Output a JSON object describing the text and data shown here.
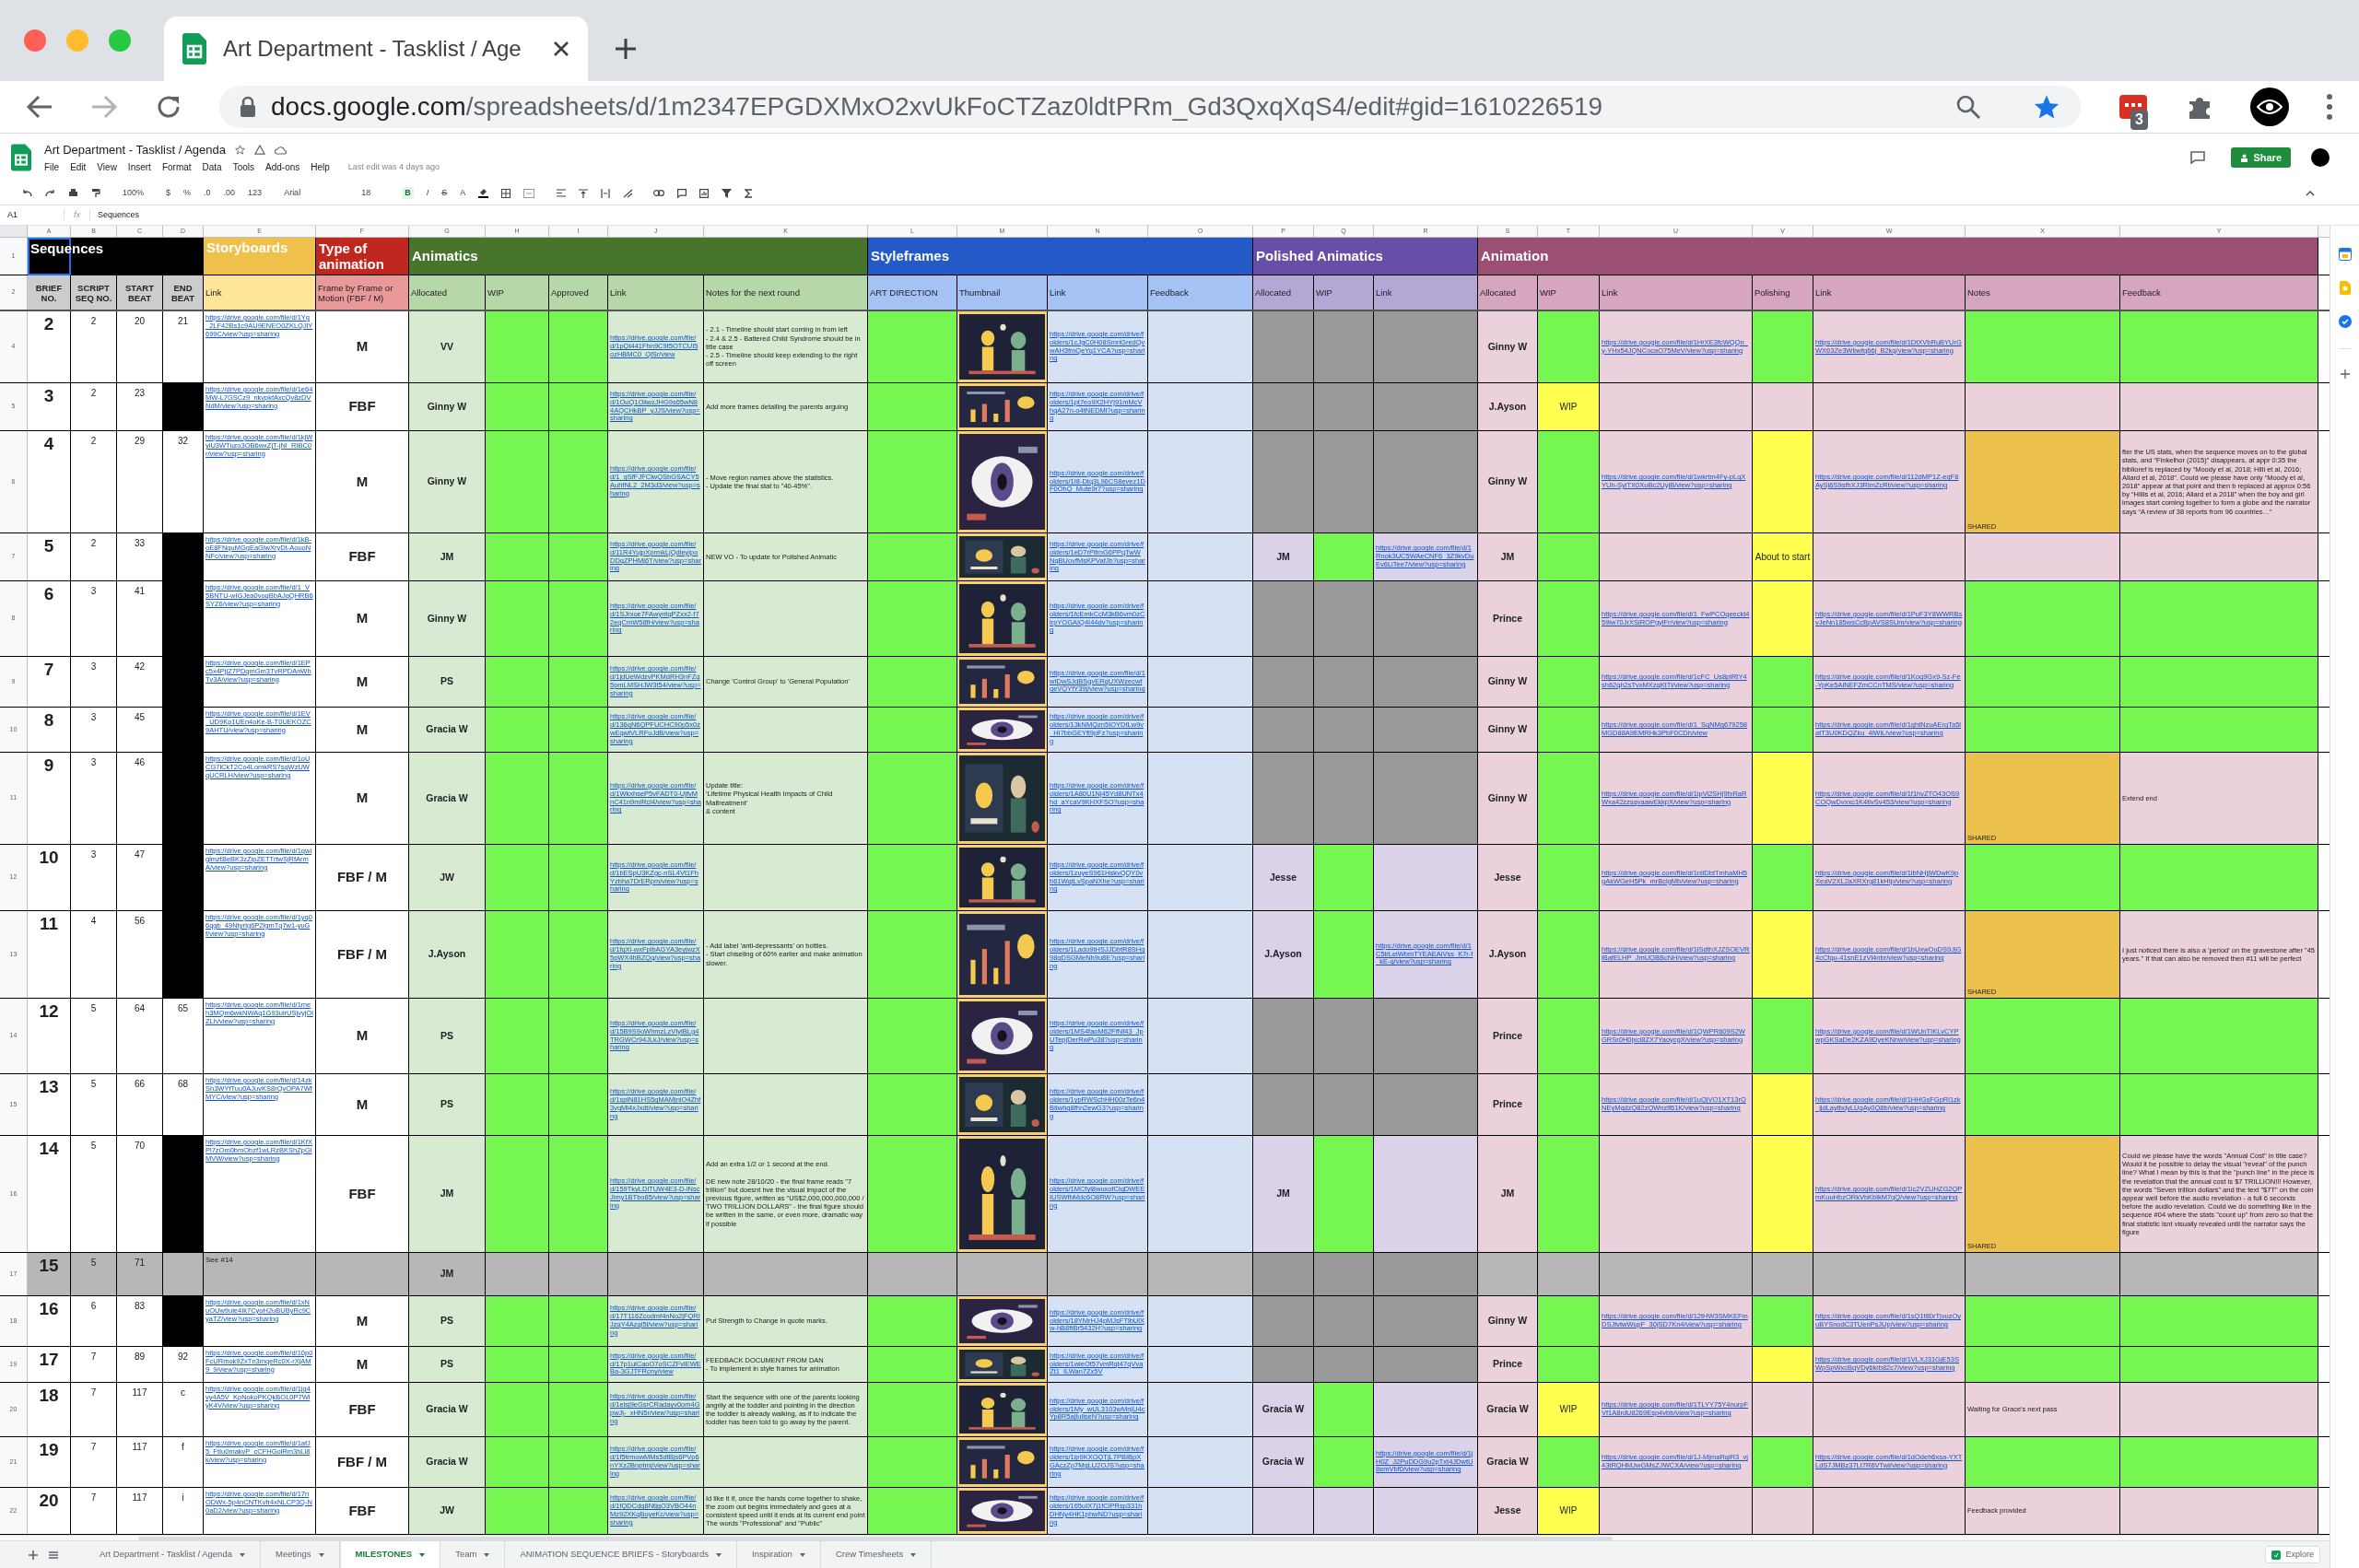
{
  "browser": {
    "tab_title": "Art Department - Tasklist / Age",
    "url_host": "docs.google.com",
    "url_path": "/spreadsheets/d/1m2347EPGDXMxO2xvUkFoCTZaz0ldtPRm_Gd3QxqXqS4/edit#gid=1610226519",
    "extension_badge": "3"
  },
  "doc": {
    "title": "Art Department - Tasklist / Agenda",
    "menu": [
      "File",
      "Edit",
      "View",
      "Insert",
      "Format",
      "Data",
      "Tools",
      "Add-ons",
      "Help"
    ],
    "last_edit": "Last edit was 4 days ago",
    "share": "Share"
  },
  "toolbar": {
    "zoom": "100%",
    "currency": "$",
    "percent": "%",
    "decrease_decimals": ".0",
    "increase_decimals": ".00",
    "number_format": "123",
    "font": "Arial",
    "font_size": "18",
    "bold": "B",
    "italic": "I",
    "strikethrough": "S",
    "text_color": "A"
  },
  "formula_bar": {
    "cell": "A1",
    "fx": "fx",
    "content": "Sequences"
  },
  "sections": [
    {
      "kind": "sequences",
      "title": "Sequences",
      "selected": true,
      "columns": [
        {
          "letter": "A",
          "header": "BRIEF NO.",
          "kind": "brief"
        },
        {
          "letter": "B",
          "header": "SCRIPT SEQ NO.",
          "kind": "number"
        },
        {
          "letter": "C",
          "header": "START BEAT",
          "kind": "number"
        },
        {
          "letter": "D",
          "header": "END BEAT",
          "kind": "number"
        }
      ]
    },
    {
      "kind": "storyboards",
      "title": "Storyboards",
      "selected": false,
      "columns": [
        {
          "letter": "E",
          "header": "Link",
          "kind": "link"
        }
      ]
    },
    {
      "kind": "type",
      "title": "Type of animation",
      "selected": false,
      "columns": [
        {
          "letter": "F",
          "header": "Frame by Frame or Motion (FBF / M)",
          "kind": "type"
        }
      ]
    },
    {
      "kind": "animatics",
      "title": "Animatics",
      "selected": false,
      "columns": [
        {
          "letter": "G",
          "header": "Allocated",
          "kind": "name"
        },
        {
          "letter": "H",
          "header": "WIP",
          "kind": "status"
        },
        {
          "letter": "I",
          "header": "Approved",
          "kind": "status"
        },
        {
          "letter": "J",
          "header": "Link",
          "kind": "link"
        },
        {
          "letter": "K",
          "header": "Notes for the next round",
          "kind": "note"
        }
      ]
    },
    {
      "kind": "styleframes",
      "title": "Styleframes",
      "selected": false,
      "columns": [
        {
          "letter": "L",
          "header": "ART DIRECTION",
          "kind": "status"
        },
        {
          "letter": "M",
          "header": "Thumbnail",
          "kind": "thumbnail"
        },
        {
          "letter": "N",
          "header": "Link",
          "kind": "link"
        },
        {
          "letter": "O",
          "header": "Feedback",
          "kind": "note"
        }
      ]
    },
    {
      "kind": "polished",
      "title": "Polished Animatics",
      "selected": false,
      "columns": [
        {
          "letter": "P",
          "header": "Allocated",
          "kind": "name"
        },
        {
          "letter": "Q",
          "header": "WIP",
          "kind": "status"
        },
        {
          "letter": "R",
          "header": "Link",
          "kind": "link"
        }
      ]
    },
    {
      "kind": "animation",
      "title": "Animation",
      "selected": false,
      "columns": [
        {
          "letter": "S",
          "header": "Allocated",
          "kind": "name"
        },
        {
          "letter": "T",
          "header": "WIP",
          "kind": "status"
        },
        {
          "letter": "U",
          "header": "Link",
          "kind": "link"
        },
        {
          "letter": "V",
          "header": "Polishing",
          "kind": "status"
        },
        {
          "letter": "W",
          "header": "Link",
          "kind": "link"
        },
        {
          "letter": "X",
          "header": "Notes",
          "kind": "note"
        },
        {
          "letter": "Y",
          "header": "Feedback",
          "kind": "note"
        }
      ]
    }
  ],
  "header_row_numbers": [
    "1",
    "2"
  ],
  "rows": [
    {
      "number": "4",
      "cells": [
        {
          "text": "2"
        },
        {
          "text": "2"
        },
        {
          "text": "20"
        },
        {
          "text": "21"
        },
        {
          "text": "https://drive.google.com/file/d/1Yg_2LF42Bs1c9AU9ENEO0ZKLQJlY699C/view?usp=sharing"
        },
        {
          "text": "M"
        },
        {
          "text": "VV"
        },
        {
          "color": "#76f650"
        },
        {
          "color": "#76f650"
        },
        {
          "text": "https://drive.google.com/file/d/1pQt441Fhn9C9t5OTCUI5ozHBMC0_QlSr/view"
        },
        {
          "text": "- 2.1 - Timeline should start coming in from left\n- 2.4 & 2.5 - Battered Child Syndrome should be in title case\n- 2.5 - Timeline should keep extending to the right off screen"
        },
        {
          "color": "#76f650"
        },
        {
          "kind": "picture"
        },
        {
          "text": "https://drive.google.com/drive/folders/1cJgC0H08SmriGredQvwAH3fmQeYq1YCA?usp=sharing"
        },
        {},
        {
          "color": "#999999"
        },
        {
          "color": "#999999"
        },
        {
          "color": "#999999"
        },
        {
          "text": "Ginny W"
        },
        {
          "color": "#76f650"
        },
        {
          "text": "https://drive.google.com/file/d/1HrXE3fcWQQn_y-YHx54JQNCocaO75MeV/view?usp=sharing"
        },
        {
          "color": "#76f650"
        },
        {
          "text": "https://drive.google.com/file/d/1DtXVbRuBYUrGWX63Ze3Wbwfq66j_B2kq/view?usp=sharing"
        },
        {
          "color": "#76f650"
        },
        {
          "color": "#76f650"
        }
      ]
    },
    {
      "number": "5",
      "cells": [
        {
          "text": "3"
        },
        {
          "text": "2"
        },
        {
          "text": "23"
        },
        {
          "color": "#000000"
        },
        {
          "text": "https://drive.google.com/file/d/1e64MW-L7GSCz9_nkvpkfAxcQv8zDVNdM/view?usp=sharing"
        },
        {
          "text": "FBF"
        },
        {
          "text": "Ginny W"
        },
        {
          "color": "#76f650"
        },
        {
          "color": "#76f650"
        },
        {
          "text": "https://drive.google.com/file/d/1OuQ1OiiwzJHG9s65wN84AQCHkBP_yJJS/view?usp=sharing"
        },
        {
          "text": "Add more frames detailing the parents arguing"
        },
        {
          "color": "#76f650"
        },
        {
          "kind": "picture"
        },
        {
          "text": "https://drive.google.com/drive/folders/1pt7eo9X2HYj91mMcVhqA27n-o4tNEDMl?usp=sharing"
        },
        {},
        {
          "color": "#999999"
        },
        {
          "color": "#999999"
        },
        {
          "color": "#999999"
        },
        {
          "text": "J.Ayson"
        },
        {
          "text": "WIP",
          "color": "#ffff50"
        },
        {},
        {},
        {},
        {},
        {}
      ]
    },
    {
      "number": "6",
      "cells": [
        {
          "text": "4"
        },
        {
          "text": "2"
        },
        {
          "text": "29"
        },
        {
          "text": "32"
        },
        {
          "text": "https://drive.google.com/file/d/1kjWyiU3WTuzo3OB6wxZjT-jNI_RIBC0r/view?usp=sharing"
        },
        {
          "text": "M"
        },
        {
          "text": "Ginny W"
        },
        {
          "color": "#76f650"
        },
        {
          "color": "#76f650"
        },
        {
          "text": "https://drive.google.com/file/d/1_gSfFJFClwQSbGSACY5AuhfNL2_2M3d3/view?usp=sharing"
        },
        {
          "text": "- Move region names above the statistics.\n- Update the final stat to \"40-45%\"."
        },
        {
          "color": "#76f650"
        },
        {
          "kind": "picture"
        },
        {
          "text": "https://drive.google.com/drive/folders/1I8-Dtq3L96CS8evez1DF0OhQ_Mute9r7?usp=sharing"
        },
        {},
        {
          "color": "#999999"
        },
        {
          "color": "#999999"
        },
        {
          "color": "#999999"
        },
        {
          "text": "Ginny W"
        },
        {
          "color": "#76f650"
        },
        {
          "text": "https://drive.google.com/file/d/1wkrtm4Fy-pLqXYUh-SyiTX0XuBc2UyjB/view?usp=sharing"
        },
        {
          "color": "#ffff50"
        },
        {
          "text": "https://drive.google.com/file/d/112dMP1Z-egF8AySj6S9sfhXJ3RlmZcRt/view?usp=sharing"
        },
        {
          "text": "SHARED",
          "color": "#ecc04c"
        },
        {
          "text": "fter the US stats, when the sequence moves on to the global stats, and “Finkelhor (2015)” disappears, at appr 0:35 the biblioref is replaced by “Moody et al, 2018; Hilli et al, 2016; Allard et al, 2018”. Could we please have only “Moody et al, 2018” appear at that point and then b replaced at approx 0:56 by “Hillis et al, 2016; Allard et a 2018” when the boy and girl images start coming together to form a globe and the narrator says “A review of 38 reports from 96 countries…”"
        }
      ]
    },
    {
      "number": "7",
      "cells": [
        {
          "text": "5"
        },
        {
          "text": "2"
        },
        {
          "text": "33"
        },
        {
          "color": "#000000"
        },
        {
          "text": "https://drive.google.com/file/d/1kB-oE8FNquMGgEaGlwXryDt-AouoNNFc/view?usp=sharing"
        },
        {
          "text": "FBF"
        },
        {
          "text": "JM"
        },
        {
          "color": "#76f650"
        },
        {
          "color": "#76f650"
        },
        {
          "text": "https://drive.google.com/file/d/11R4YujpXprmkLjQdleyipoDDqZPHMj6T/view?usp=sharing"
        },
        {
          "text": "NEW VO - To update for Polished Animatic"
        },
        {
          "color": "#76f650"
        },
        {
          "kind": "picture"
        },
        {
          "text": "https://drive.google.com/drive/folders/1eD7rPlfmG6PPqTwWNqBUovfMsKPVafJb?usp=sharing"
        },
        {},
        {
          "text": "JM"
        },
        {
          "color": "#76f650"
        },
        {
          "text": "https://drive.google.com/file/d/1Rnok3UC5WAeCNF6_3Z9kvDuEv6LiTee7/view?usp=sharing"
        },
        {
          "text": "JM"
        },
        {
          "color": "#76f650"
        },
        {},
        {
          "text": "About to start",
          "color": "#ffff50"
        },
        {},
        {},
        {}
      ]
    },
    {
      "number": "8",
      "cells": [
        {
          "text": "6"
        },
        {
          "text": "3"
        },
        {
          "text": "41"
        },
        {
          "color": "#000000"
        },
        {
          "text": "https://drive.google.com/file/d/1_V5BNTU-wIGJea0voqBbAJqQHRB6SYZ6/view?usp=sharing"
        },
        {
          "text": "M"
        },
        {
          "text": "Ginny W"
        },
        {
          "color": "#76f650"
        },
        {
          "color": "#76f650"
        },
        {
          "text": "https://drive.google.com/file/d/1SJrxoe7FAwyntqPZxx2-f72eqCmW58fH/view?usp=sharing"
        },
        {},
        {
          "color": "#76f650"
        },
        {
          "kind": "picture"
        },
        {
          "text": "https://drive.google.com/drive/folders/1fcEmkCcM3kB6vm0zClrpYOGAIQ4I44dv?usp=sharing"
        },
        {},
        {
          "color": "#999999"
        },
        {
          "color": "#999999"
        },
        {
          "color": "#999999"
        },
        {
          "text": "Prince"
        },
        {
          "color": "#76f650"
        },
        {
          "text": "https://drive.google.com/file/d/1_FwPCOqeeckt459iw70JrXSiROPgylFr/view?usp=sharing"
        },
        {
          "color": "#ffff50"
        },
        {
          "text": "https://drive.google.com/file/d/1PuF3Y8WWRBsvJeNn185wsCcBpAVS8SUm/view?usp=sharing"
        },
        {
          "color": "#76f650"
        },
        {
          "color": "#76f650"
        }
      ]
    },
    {
      "number": "9",
      "cells": [
        {
          "text": "7"
        },
        {
          "text": "3"
        },
        {
          "text": "42"
        },
        {
          "color": "#000000"
        },
        {
          "text": "https://drive.google.com/file/d/1EPc5x4PjjZ7PDqmGm3TvRPDAnWhTv3A/view?usp=sharing"
        },
        {
          "text": "M"
        },
        {
          "text": "PS"
        },
        {
          "color": "#76f650"
        },
        {
          "color": "#76f650"
        },
        {
          "text": "https://drive.google.com/file/d/1jdUeWdzvPKMdRH3nFZq5pmLMSHJW3t54/view?usp=sharing"
        },
        {
          "text": "Change 'Control Group' to 'General Population'"
        },
        {
          "color": "#76f650"
        },
        {
          "kind": "picture"
        },
        {
          "text": "https://drive.google.com/file/d/1wtDwSJdBSgvERqUXWzecwfqeVQYfY39j/view?usp=sharing"
        },
        {},
        {
          "color": "#999999"
        },
        {
          "color": "#999999"
        },
        {
          "color": "#999999"
        },
        {
          "text": "Ginny W"
        },
        {
          "color": "#76f650"
        },
        {
          "text": "https://drive.google.com/file/d/1cFC_Us8piRtY4sh62qh2sTvxMXzqKtTi/view?usp=sharing"
        },
        {
          "color": "#76f650"
        },
        {
          "text": "https://drive.google.com/file/d/1Koq9Gx9-Sz-Fe-YpKe5AlNEFZmCCnTMS/view?usp=sharing"
        },
        {
          "color": "#76f650"
        },
        {
          "color": "#76f650"
        }
      ]
    },
    {
      "number": "10",
      "cells": [
        {
          "text": "8"
        },
        {
          "text": "3"
        },
        {
          "text": "45"
        },
        {
          "color": "#000000"
        },
        {
          "text": "https://drive.google.com/file/d/1EV_UD9Kp1UEn4oKe-B-T0UEKOZC9AHTU/view?usp=sharing"
        },
        {
          "text": "M"
        },
        {
          "text": "Gracia W"
        },
        {
          "color": "#76f650"
        },
        {
          "color": "#76f650"
        },
        {
          "text": "https://drive.google.com/file/d/136qN6QPFUCHC90p5x0zwEqwtVLRFuJdB/view?usp=sharing"
        },
        {},
        {
          "color": "#76f650"
        },
        {
          "kind": "picture"
        },
        {
          "text": "https://drive.google.com/drive/folders/13kNMQzn5IOYDtLw9v_HI7bbGEYfl9pFz?usp=sharing"
        },
        {},
        {
          "color": "#999999"
        },
        {
          "color": "#999999"
        },
        {
          "color": "#999999"
        },
        {
          "text": "Ginny W"
        },
        {
          "color": "#76f650"
        },
        {
          "text": "https://drive.google.com/file/d/1_SqNMg679258MGD88A9EMRHk3PbF0CDh/view"
        },
        {
          "color": "#76f650"
        },
        {
          "text": "https://drive.google.com/file/d/1ghtNzuAErqTa5latT3U0KDQZku_4iWiL/view?usp=sharing"
        },
        {
          "color": "#76f650"
        },
        {
          "color": "#76f650"
        }
      ]
    },
    {
      "number": "11",
      "cells": [
        {
          "text": "9"
        },
        {
          "text": "3"
        },
        {
          "text": "46"
        },
        {
          "color": "#000000"
        },
        {
          "text": "https://drive.google.com/file/d/1oUCG7lCkT2Co4LomkRS7sqWzUWqUCRLH/view?usp=sharing"
        },
        {
          "text": "M"
        },
        {
          "text": "Gracia W"
        },
        {
          "color": "#76f650"
        },
        {
          "color": "#76f650"
        },
        {
          "text": "https://drive.google.com/file/d/1WkxhseP5vFADT0-UjfvMnC41n9mlRcl4/view?usp=sharing"
        },
        {
          "text": "Update title:\n'Lifetime Physical Health Impacts of Child Maltreatment'\n& content"
        },
        {
          "color": "#76f650"
        },
        {
          "kind": "picture"
        },
        {
          "text": "https://drive.google.com/drive/folders/1A80U1Nj45Yd8UNTx4hd_aYcaV9KHXFSO?usp=sharing"
        },
        {},
        {
          "color": "#999999"
        },
        {
          "color": "#999999"
        },
        {
          "color": "#999999"
        },
        {
          "text": "Ginny W"
        },
        {
          "color": "#76f650"
        },
        {
          "text": "https://drive.google.com/file/d/1ipVi2SHj9fxRaRWxa42zzsqvaawEkkpX/view?usp=sharing"
        },
        {
          "color": "#ffff50"
        },
        {
          "text": "https://drive.google.com/file/d/1f1hvZTO43OS9COQwDvxxc1K4tivSv453/view?usp=sharing"
        },
        {
          "text": "SHARED",
          "color": "#ecc04c"
        },
        {
          "text": "Extend end"
        }
      ]
    },
    {
      "number": "12",
      "cells": [
        {
          "text": "10"
        },
        {
          "text": "3"
        },
        {
          "text": "47"
        },
        {
          "color": "#000000"
        },
        {
          "text": "https://drive.google.com/file/d/1qwiglmztBeBK3zZipZETTrtwSjRfArmA/view?usp=sharing"
        },
        {
          "text": "FBF / M"
        },
        {
          "text": "JW"
        },
        {
          "color": "#76f650"
        },
        {
          "color": "#76f650"
        },
        {
          "text": "https://drive.google.com/file/d/1bESpU3KZgc-nSL4Vt1FhYzbha7DrERpm/view?usp=sharing"
        },
        {},
        {
          "color": "#76f650"
        },
        {
          "kind": "picture"
        },
        {
          "text": "https://drive.google.com/drive/folders/1zuyeS961HskvQQY0vb61WqtLvSpaNXhe?usp=sharing"
        },
        {},
        {
          "text": "Jesse"
        },
        {
          "color": "#76f650"
        },
        {},
        {
          "text": "Jesse"
        },
        {
          "color": "#76f650"
        },
        {
          "text": "https://drive.google.com/file/d/1nliDbtTmhaMH5gAkWGeH5Pk_mrBclgMb/view?usp=sharing"
        },
        {
          "color": "#76f650"
        },
        {
          "text": "https://drive.google.com/file/d/1lbNHjjWDwK9pXeaV2XL2aXRXrg81kHIp/view?usp=sharing"
        },
        {
          "color": "#76f650"
        },
        {
          "color": "#76f650"
        }
      ]
    },
    {
      "number": "13",
      "cells": [
        {
          "text": "11"
        },
        {
          "text": "4"
        },
        {
          "text": "56"
        },
        {
          "color": "#000000"
        },
        {
          "text": "https://drive.google.com/file/d/1yq06qgb_49NtyrIg6P2lgmTq7w1-yuGf/view?usp=sharing"
        },
        {
          "text": "FBF / M"
        },
        {
          "text": "J.Ayson"
        },
        {
          "color": "#76f650"
        },
        {
          "color": "#76f650"
        },
        {
          "text": "https://drive.google.com/file/d/1fqXi-wxFplbAGYA3eyjwzX5pWX4hBZQq/view?usp=sharing"
        },
        {
          "text": "- Add label 'anti-depressants' on bottles.\n- Start chiseling of 60% earlier and make animation slower."
        },
        {
          "color": "#76f650"
        },
        {
          "kind": "picture"
        },
        {
          "text": "https://drive.google.com/drive/folders/1Lado9tHSJJDbtR8SHg98gDSGMeNh9u8E?usp=sharing"
        },
        {},
        {
          "text": "J.Ayson"
        },
        {
          "color": "#76f650"
        },
        {
          "text": "https://drive.google.com/file/d/1C5lrLeiWbmTYEAEAiVss_K7r-f_kE-q/view?usp=sharing"
        },
        {
          "text": "J.Ayson"
        },
        {
          "color": "#76f650"
        },
        {
          "text": "https://drive.google.com/file/d/1lSdthXJZSOEVRlBafELHP_JmUQBBcNH/view?usp=sharing"
        },
        {
          "color": "#ffff50"
        },
        {
          "text": "https://drive.google.com/file/d/1bUxwOuDS9JjG4cCfqu-41snE1zVl4nbr/view?usp=sharing"
        },
        {
          "text": "SHARED",
          "color": "#ecc04c"
        },
        {
          "text": "I just noticed there is also a 'period' on the gravestone after \"45 years.\" If that can also be removed then #11 will be perfect"
        }
      ]
    },
    {
      "number": "14",
      "cells": [
        {
          "text": "12"
        },
        {
          "text": "5"
        },
        {
          "text": "64"
        },
        {
          "text": "65"
        },
        {
          "text": "https://drive.google.com/file/d/1meh3MQm6wkNWAq1G93ulrUSjvyjOlZLh/view?usp=sharing"
        },
        {
          "text": "M"
        },
        {
          "text": "PS"
        },
        {
          "color": "#76f650"
        },
        {
          "color": "#76f650"
        },
        {
          "text": "https://drive.google.com/file/d/15B9S9oWhmzLzVIyiBLg4TRGWCr94JLkJ/view?usp=sharing"
        },
        {},
        {
          "color": "#76f650"
        },
        {
          "kind": "picture"
        },
        {
          "text": "https://drive.google.com/drive/folders/1MS4faoM62FfNf43_JpUTepjDerRwPu38?usp=sharing"
        },
        {},
        {
          "color": "#999999"
        },
        {
          "color": "#999999"
        },
        {
          "color": "#999999"
        },
        {
          "text": "Prince"
        },
        {
          "color": "#76f650"
        },
        {
          "text": "https://drive.google.com/file/d/1QWPR609S2WGRSr0H0jxci8ZX7YaoycgX/view?usp=sharing"
        },
        {
          "color": "#76f650"
        },
        {
          "text": "https://drive.google.com/file/d/1WUnTIKLvCYPwpGKSaDe2KZA9DyeKNnw/view?usp=sharing"
        },
        {
          "color": "#76f650"
        },
        {
          "color": "#76f650"
        }
      ]
    },
    {
      "number": "15",
      "cells": [
        {
          "text": "13"
        },
        {
          "text": "5"
        },
        {
          "text": "66"
        },
        {
          "text": "68"
        },
        {
          "text": "https://drive.google.com/file/d/14zkSh3WYfTuu0AJuvKS8rQvOPA7WfMYC/view?usp=sharing"
        },
        {
          "text": "M"
        },
        {
          "text": "PS"
        },
        {
          "color": "#76f650"
        },
        {
          "color": "#76f650"
        },
        {
          "text": "https://drive.google.com/file/d/1splN81HS5qMAMjnlO4Zhf3vgMl4xJxdt/view?usp=sharing"
        },
        {},
        {
          "color": "#76f650"
        },
        {
          "kind": "picture"
        },
        {
          "text": "https://drive.google.com/drive/folders/1ypRWSchHH00zTe6n4BIlwhg8fhn2ewG3?usp=sharing"
        },
        {},
        {
          "color": "#999999"
        },
        {
          "color": "#999999"
        },
        {
          "color": "#999999"
        },
        {
          "text": "Prince"
        },
        {
          "color": "#76f650"
        },
        {
          "text": "https://drive.google.com/file/d/1uQjVO1XT13rQNEyMgdzQ82zQWnzlf61K/view?usp=sharing"
        },
        {
          "color": "#ffff50"
        },
        {
          "text": "https://drive.google.com/file/d/1HHGsFGpRl1zk_jjdLaytbdyLUqAy0Q8b/view?usp=sharing"
        },
        {
          "color": "#76f650"
        },
        {
          "color": "#76f650"
        }
      ]
    },
    {
      "number": "16",
      "cells": [
        {
          "text": "14"
        },
        {
          "text": "5"
        },
        {
          "text": "70"
        },
        {
          "color": "#000000"
        },
        {
          "text": "https://drive.google.com/file/d/1KfXPl7zOm0bmObzf1wLRzBKShZpGlMVW/view?usp=sharing"
        },
        {
          "text": "FBF"
        },
        {
          "text": "JM"
        },
        {
          "color": "#76f650"
        },
        {
          "color": "#76f650"
        },
        {
          "text": "https://drive.google.com/file/d/159TkyLDlTUW4E3-D-lNscJimy1BTbo85/view?usp=sharing"
        },
        {
          "text": "Add an extra 1/2 or 1 second at the end.\n\nDE new note 28/10/20 - the final frame reads \"7 trillion\" but doesnt hve the visual impact of the previous figure, written as \"US$2,000,000,000,000 / TWO TRILLION DOLLARS\" - the final figure should be written in the same, or even more, dramatic way if possible"
        },
        {
          "color": "#76f650"
        },
        {
          "kind": "picture"
        },
        {
          "text": "https://drive.google.com/drive/folders/1MCfyi8wuxofClqDWEEIUSWfbMdc6O8RW?usp=sharing"
        },
        {},
        {
          "text": "JM"
        },
        {
          "color": "#76f650"
        },
        {},
        {
          "text": "JM"
        },
        {
          "color": "#76f650"
        },
        {},
        {
          "color": "#ffff50"
        },
        {
          "text": "https://drive.google.com/file/d/1ic2VZUHZG2QPmKuuHbzORkVbKblkM7gQ/view?usp=sharing"
        },
        {
          "text": "SHARED",
          "color": "#ecc04c"
        },
        {
          "text": "Could we please have the words \"Annual Cost\" in title case?\nWould it be possible to delay the visual \"reveal\" of the punch line? What I mean by this is that the \"punch line\" in the piece is the revelation that the annual cost is $7 TRILLION!!! However, the words \"Seven trillion dollars\" and the text \"$7T\" on the coin appear well before the audio revelation - a full 6 seconds before the audio revelation. Could we do something like in the sequence #04 where the stats \"count up\" from zero so that the final statistic isnt visually revealed until the narrator says the figure"
        }
      ]
    },
    {
      "number": "17",
      "cells": [
        {
          "text": "15",
          "color": "#b7b7b7"
        },
        {
          "text": "5",
          "color": "#b7b7b7"
        },
        {
          "text": "71",
          "color": "#b7b7b7"
        },
        {
          "color": "#b7b7b7"
        },
        {
          "text": "See #14",
          "kind": "text",
          "color": "#b7b7b7"
        },
        {
          "color": "#b7b7b7"
        },
        {
          "text": "JM",
          "color": "#b7b7b7"
        },
        {
          "color": "#b7b7b7"
        },
        {
          "color": "#b7b7b7"
        },
        {
          "color": "#b7b7b7"
        },
        {
          "color": "#b7b7b7"
        },
        {
          "color": "#b7b7b7"
        },
        {
          "color": "#b7b7b7"
        },
        {
          "color": "#b7b7b7"
        },
        {
          "color": "#b7b7b7"
        },
        {
          "color": "#999999"
        },
        {
          "color": "#999999"
        },
        {
          "color": "#999999"
        },
        {
          "color": "#b7b7b7"
        },
        {
          "color": "#b7b7b7"
        },
        {
          "color": "#b7b7b7"
        },
        {
          "color": "#b7b7b7"
        },
        {
          "color": "#b7b7b7"
        },
        {
          "color": "#b7b7b7"
        },
        {
          "color": "#b7b7b7"
        }
      ]
    },
    {
      "number": "18",
      "cells": [
        {
          "text": "16"
        },
        {
          "text": "6"
        },
        {
          "text": "83"
        },
        {
          "color": "#000000"
        },
        {
          "text": "https://drive.google.com/file/d/1xNuOUw9ule4Ik7CyoH2uBUByRc9CyaTZ/view?usp=sharing"
        },
        {
          "text": "M"
        },
        {
          "text": "PS"
        },
        {
          "color": "#76f650"
        },
        {
          "color": "#76f650"
        },
        {
          "text": "https://drive.google.com/file/d/17T116Zcodmf4nNo2jFQRIJzqY4Azql5l/view?usp=sharing"
        },
        {
          "text": "Put Strength to Change in quote marks."
        },
        {
          "color": "#76f650"
        },
        {
          "kind": "picture"
        },
        {
          "text": "https://drive.google.com/drive/folders/18YMrHJ4pMJsFTlbUlXw-hB8ftBr5432H?usp=sharing"
        },
        {},
        {
          "color": "#999999"
        },
        {
          "color": "#999999"
        },
        {
          "color": "#999999"
        },
        {
          "text": "Ginny W"
        },
        {
          "color": "#76f650"
        },
        {
          "text": "https://drive.google.com/file/d/12tHW3SMKEFmDSJtvtwWupF_30jSD7Kn4/view?usp=sharing"
        },
        {
          "color": "#76f650"
        },
        {
          "text": "https://drive.google.com/file/d/1sQ1f80rTjvuzOyuBYSnodC3TUenPsJUp/view?usp=sharing"
        },
        {
          "color": "#76f650"
        },
        {
          "color": "#76f650"
        }
      ]
    },
    {
      "number": "19",
      "cells": [
        {
          "text": "17"
        },
        {
          "text": "7"
        },
        {
          "text": "89"
        },
        {
          "text": "92"
        },
        {
          "text": "https://drive.google.com/file/d/10p0FcURmok9ZxTn3mqeRc0X-rXjAM9_9/view?usp=sharing"
        },
        {
          "text": "M"
        },
        {
          "text": "PS"
        },
        {
          "color": "#76f650"
        },
        {
          "color": "#76f650"
        },
        {
          "text": "https://drive.google.com/file/d/17p1ulCaoO7oSCZFvlEWEBa-3GJTFRcny/view"
        },
        {
          "text": "FEEDBACK DOCUMENT FROM DAN\n- To implement in style frames for animation"
        },
        {
          "color": "#76f650"
        },
        {
          "kind": "picture"
        },
        {
          "text": "https://drive.google.com/drive/folders/1wieOt57vmRqt47qVvaZt1_ILWan7Zx5V"
        },
        {},
        {
          "color": "#999999"
        },
        {
          "color": "#999999"
        },
        {
          "color": "#999999"
        },
        {
          "text": "Prince"
        },
        {
          "color": "#76f650"
        },
        {},
        {
          "color": "#ffff50"
        },
        {
          "text": "https://drive.google.com/file/d/1VLXJ31GjE53SWpSpWxcBqVDy6krb82c7/view?usp=sharing"
        },
        {
          "color": "#76f650"
        },
        {
          "color": "#76f650"
        }
      ]
    },
    {
      "number": "20",
      "cells": [
        {
          "text": "18"
        },
        {
          "text": "7"
        },
        {
          "text": "117"
        },
        {
          "text": "c"
        },
        {
          "text": "https://drive.google.com/file/d/1jg4vy4A5V_KpNokoPKQkBOL0P7WlyK4V/view?usp=sharing"
        },
        {
          "text": "FBF"
        },
        {
          "text": "Gracia W"
        },
        {
          "color": "#76f650"
        },
        {
          "color": "#76f650"
        },
        {
          "text": "https://drive.google.com/file/d/1elsj9eGsrCRadayv0om4GpwJj-_xHN5r/view?usp=sharing"
        },
        {
          "text": "Start the sequence with one of the parents looking angrily at the toddler and pointing in the direction the toddler is already walking, as if to indicate the toddler has been told to go away by the parent."
        },
        {
          "color": "#76f650"
        },
        {
          "kind": "picture"
        },
        {
          "text": "https://drive.google.com/drive/folders/1My_wUL3103wMnjU4cYp8R5ajIuliseN?usp=sharing"
        },
        {},
        {
          "text": "Gracia W"
        },
        {
          "color": "#76f650"
        },
        {},
        {
          "text": "Gracia W"
        },
        {
          "text": "WIP",
          "color": "#ffff50"
        },
        {
          "text": "https://drive.google.com/file/d/1TLYY75Y4nurpFVf1A8rdU8269Esp4vbb/view?usp=sharing"
        },
        {},
        {},
        {
          "text": "Waiting for Grace's next pass"
        },
        {}
      ]
    },
    {
      "number": "21",
      "cells": [
        {
          "text": "19"
        },
        {
          "text": "7"
        },
        {
          "text": "117"
        },
        {
          "text": "f"
        },
        {
          "text": "https://drive.google.com/file/d/1afJ5_FtIu0makvP_cCFHGolRm3hLl8k/view?usp=sharing"
        },
        {
          "text": "FBF / M"
        },
        {
          "text": "Gracia W"
        },
        {
          "color": "#76f650"
        },
        {
          "color": "#76f650"
        },
        {
          "text": "https://drive.google.com/file/d/1f5trmowMMs5dtBjs6PVp6nYXz2Bnptmj/view?usp=sharing"
        },
        {},
        {
          "color": "#76f650"
        },
        {
          "kind": "picture"
        },
        {
          "text": "https://drive.google.com/drive/folders/1ip9KXOQTjL7PBIBpXGAczZp7MgLU2OJS?usp=sharing"
        },
        {},
        {
          "text": "Gracia W"
        },
        {
          "color": "#76f650"
        },
        {
          "text": "https://drive.google.com/file/d/1jH0Z_J2PuDDG9u2pTxt4JDwtU8emVbf0/view?usp=sharing"
        },
        {
          "text": "Gracia W"
        },
        {
          "color": "#76f650"
        },
        {
          "text": "https://drive.google.com/file/d/1J-MjmaRqiR3_vj43tRQHMJwGMsZJWCXA/view?usp=sharing"
        },
        {
          "color": "#76f650"
        },
        {
          "text": "https://drive.google.com/file/d/1dOdeh6xsa-YXTLdS7JMBz37Lt7R6VTwl/view?usp=sharing"
        },
        {
          "color": "#76f650"
        },
        {
          "color": "#76f650"
        }
      ]
    },
    {
      "number": "22",
      "cells": [
        {
          "text": "20"
        },
        {
          "text": "7"
        },
        {
          "text": "117"
        },
        {
          "text": "i"
        },
        {
          "text": "https://drive.google.com/file/d/17nODWx-5p4nCNTKvfr4xNLCP3Q-N0aD2/view?usp=sharing"
        },
        {
          "text": "FBF"
        },
        {
          "text": "JW"
        },
        {
          "color": "#76f650"
        },
        {
          "color": "#76f650"
        },
        {
          "text": "https://drive.google.com/file/d/1fQDCdg8NtjgO3VBO44nMz92XKqBoyeKc/view?usp=sharing"
        },
        {
          "text": "Id like it if, once the hands come together to shake, the zoom out begins immediately and goes at a consistent speed until it ends at its current end point\nThe words \"Professional\" and \"Public\""
        },
        {
          "color": "#76f650"
        },
        {
          "kind": "picture"
        },
        {
          "text": "https://drive.google.com/drive/folders/165uIX7j1fClPRsp331hDHNy4HK1phwND?usp=sharing"
        },
        {},
        {},
        {},
        {},
        {
          "text": "Jesse"
        },
        {
          "text": "WIP",
          "color": "#ffff50"
        },
        {},
        {},
        {},
        {
          "text": "Feedback provided"
        },
        {}
      ]
    }
  ],
  "sheet_tabs": [
    {
      "label": "Art Department - Tasklist / Agenda",
      "selected": false
    },
    {
      "label": "Meetings",
      "selected": false
    },
    {
      "label": "MILESTONES",
      "selected": true
    },
    {
      "label": "Team",
      "selected": false
    },
    {
      "label": "ANIMATION SEQUENCE BRIEFS - Storyboards",
      "selected": false
    },
    {
      "label": "Inspiration",
      "selected": false
    },
    {
      "label": "Crew Timesheets",
      "selected": false
    }
  ],
  "explore": "Explore"
}
